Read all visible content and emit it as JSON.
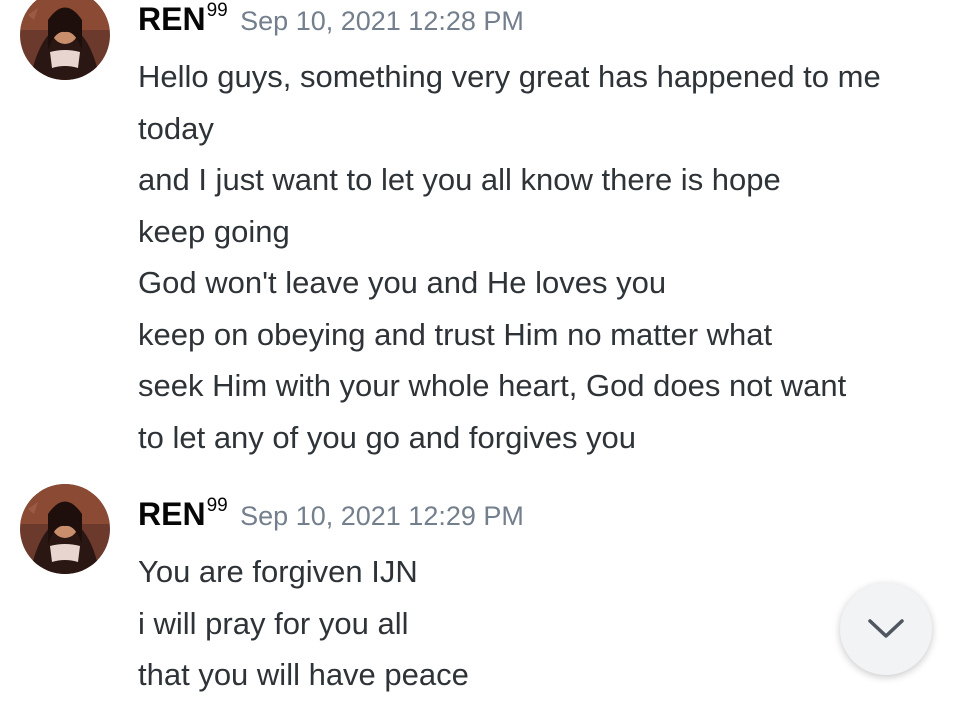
{
  "messages": [
    {
      "username": "REN",
      "username_sup": "99",
      "timestamp": "Sep 10, 2021 12:28 PM",
      "lines": [
        "Hello guys, something very great has happened to me",
        "today",
        "and I just want to let you all know there is hope",
        "keep going",
        "God won't leave you and He loves you",
        "keep on obeying and trust Him no matter what",
        "seek Him with your whole heart, God does not want",
        "to let any of you go and forgives you"
      ]
    },
    {
      "username": "REN",
      "username_sup": "99",
      "timestamp": "Sep 10, 2021 12:29 PM",
      "lines": [
        "You are forgiven IJN",
        "i will pray for you all",
        "that you will have peace"
      ]
    }
  ],
  "icons": {
    "avatar": "avatar-image",
    "scroll_button": "chevron-down-icon"
  },
  "colors": {
    "username": "#060607",
    "timestamp": "#747f8d",
    "message_text": "#2e3338",
    "background": "#ffffff",
    "scroll_button_bg": "#f2f3f5"
  }
}
